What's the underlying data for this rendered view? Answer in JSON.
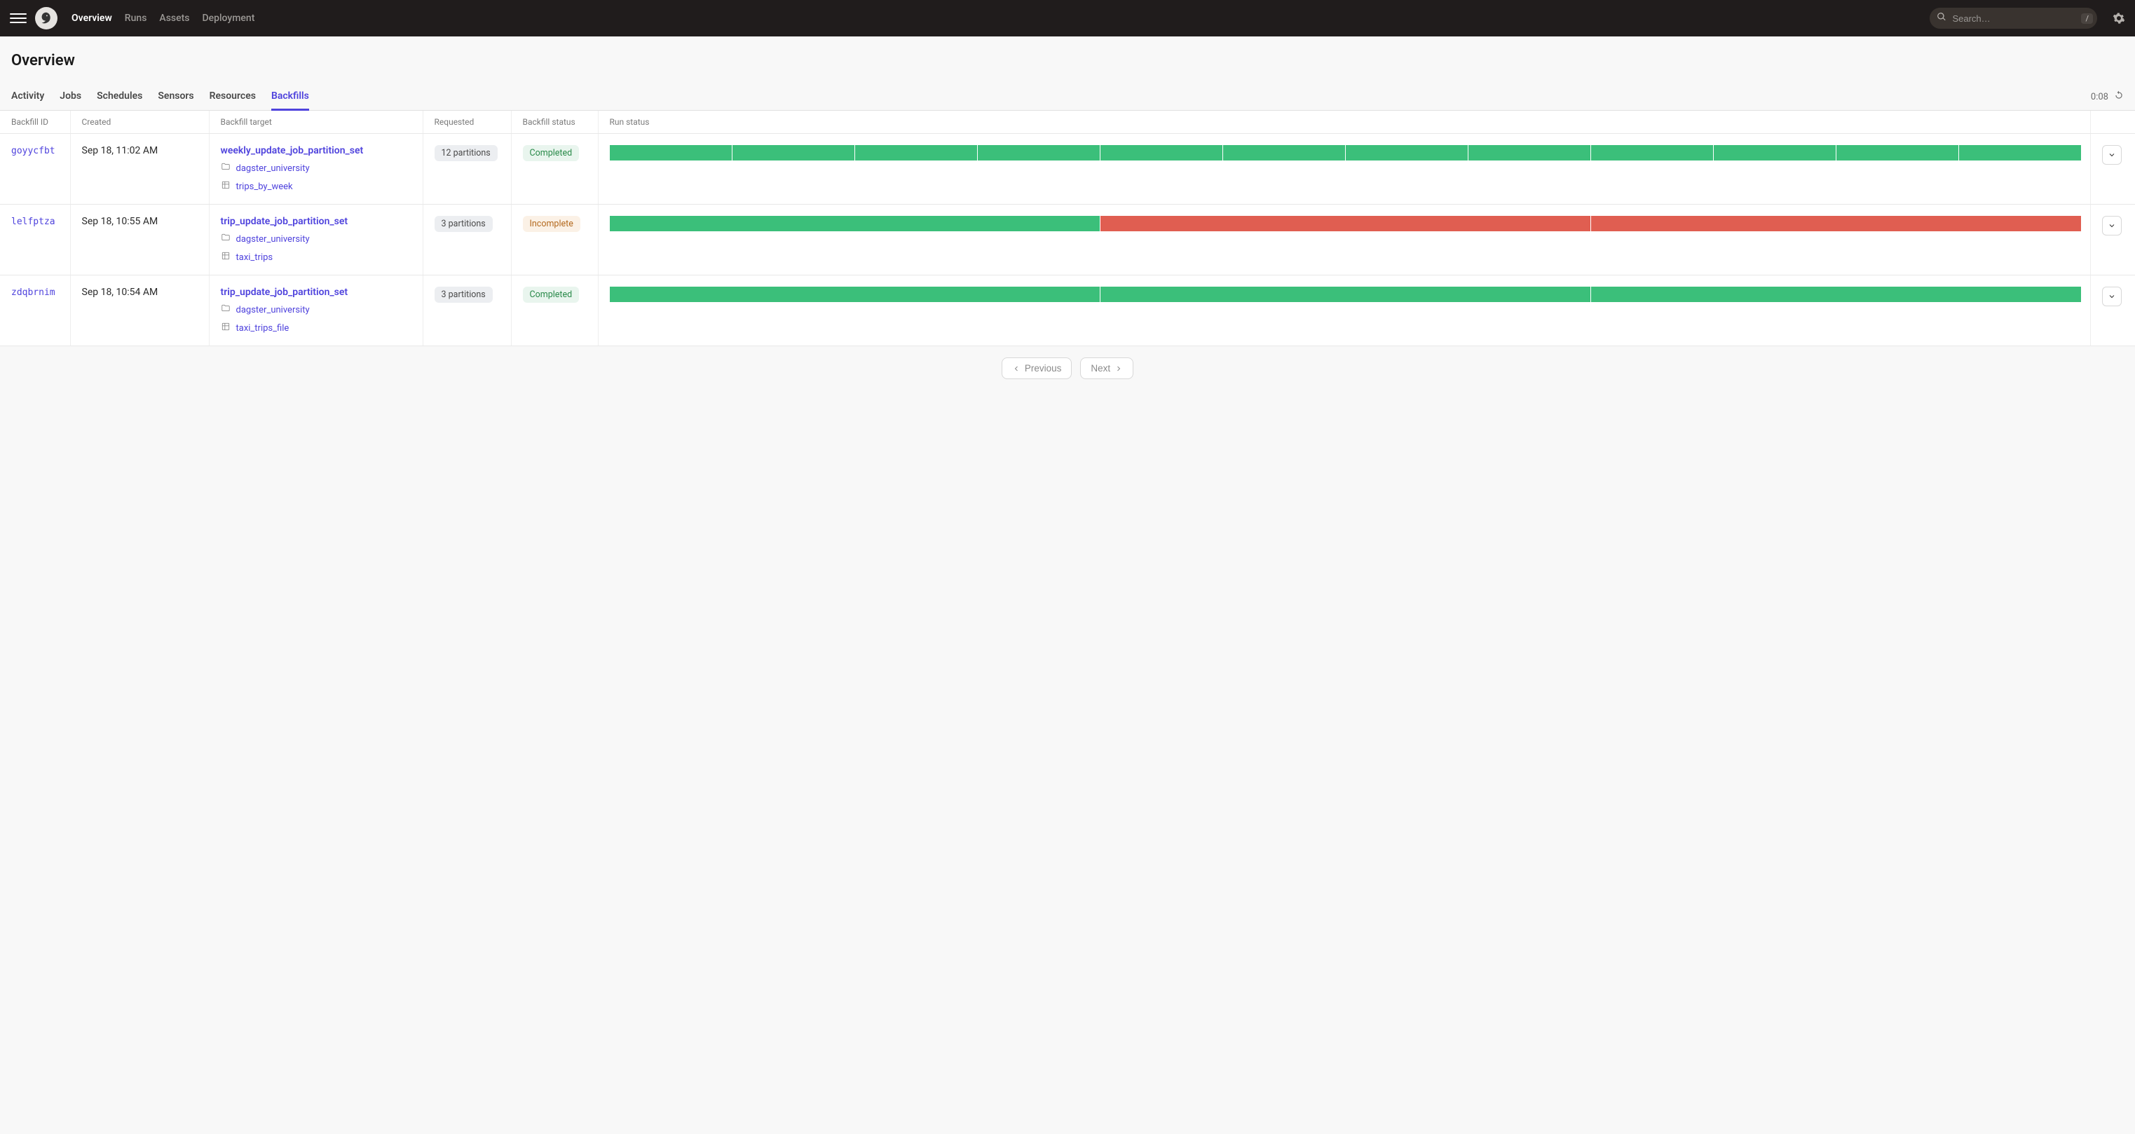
{
  "nav": {
    "links": [
      "Overview",
      "Runs",
      "Assets",
      "Deployment"
    ],
    "active": "Overview",
    "search_placeholder": "Search…",
    "search_hotkey": "/"
  },
  "page": {
    "title": "Overview",
    "refresh_countdown": "0:08"
  },
  "tabs": {
    "items": [
      "Activity",
      "Jobs",
      "Schedules",
      "Sensors",
      "Resources",
      "Backfills"
    ],
    "active": "Backfills"
  },
  "columns": {
    "id": "Backfill ID",
    "created": "Created",
    "target": "Backfill target",
    "requested": "Requested",
    "status": "Backfill status",
    "run_status": "Run status",
    "menu": ""
  },
  "rows": [
    {
      "id": "goyycfbt",
      "created": "Sep 18, 11:02 AM",
      "target": {
        "name": "weekly_update_job_partition_set",
        "repo": "dagster_university",
        "asset": "trips_by_week"
      },
      "requested": "12 partitions",
      "status": {
        "label": "Completed",
        "kind": "green"
      },
      "run_segments": [
        "green",
        "green",
        "green",
        "green",
        "green",
        "green",
        "green",
        "green",
        "green",
        "green",
        "green",
        "green"
      ]
    },
    {
      "id": "lelfptza",
      "created": "Sep 18, 10:55 AM",
      "target": {
        "name": "trip_update_job_partition_set",
        "repo": "dagster_university",
        "asset": "taxi_trips"
      },
      "requested": "3 partitions",
      "status": {
        "label": "Incomplete",
        "kind": "orange"
      },
      "run_segments": [
        "green",
        "red",
        "red"
      ]
    },
    {
      "id": "zdqbrnim",
      "created": "Sep 18, 10:54 AM",
      "target": {
        "name": "trip_update_job_partition_set",
        "repo": "dagster_university",
        "asset": "taxi_trips_file"
      },
      "requested": "3 partitions",
      "status": {
        "label": "Completed",
        "kind": "green"
      },
      "run_segments": [
        "green",
        "green",
        "green"
      ]
    }
  ],
  "pagination": {
    "prev": "Previous",
    "next": "Next"
  }
}
